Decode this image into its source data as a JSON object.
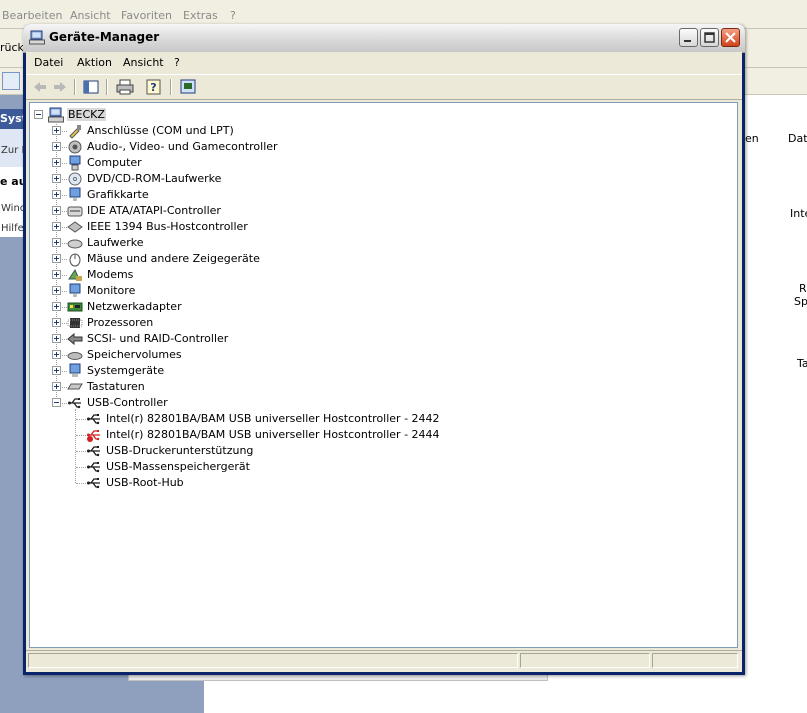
{
  "background_window": {
    "menu": [
      "Bearbeiten",
      "Ansicht",
      "Favoriten",
      "Extras",
      "?"
    ],
    "back_label": "rück",
    "left_pane": {
      "header": "Syst",
      "items": [
        "Zur K"
      ],
      "section": "e au",
      "links": [
        "Winc",
        "Hilfe"
      ]
    },
    "right_text": [
      "en",
      "Datu",
      "Inte",
      "R",
      "Sp",
      "Ta"
    ]
  },
  "device_manager": {
    "title": "Geräte-Manager",
    "menu": [
      "Datei",
      "Aktion",
      "Ansicht",
      "?"
    ],
    "tree": {
      "root": "BECKZ",
      "categories": [
        {
          "label": "Anschlüsse (COM und LPT)",
          "icon": "port-icon",
          "expanded": false
        },
        {
          "label": "Audio-, Video- und Gamecontroller",
          "icon": "speaker-icon",
          "expanded": false
        },
        {
          "label": "Computer",
          "icon": "computer-icon",
          "expanded": false
        },
        {
          "label": "DVD/CD-ROM-Laufwerke",
          "icon": "cdrom-icon",
          "expanded": false
        },
        {
          "label": "Grafikkarte",
          "icon": "monitor-icon",
          "expanded": false
        },
        {
          "label": "IDE ATA/ATAPI-Controller",
          "icon": "ide-controller-icon",
          "expanded": false
        },
        {
          "label": "IEEE 1394 Bus-Hostcontroller",
          "icon": "firewire-icon",
          "expanded": false
        },
        {
          "label": "Laufwerke",
          "icon": "disk-drive-icon",
          "expanded": false
        },
        {
          "label": "Mäuse und andere Zeigegeräte",
          "icon": "mouse-icon",
          "expanded": false
        },
        {
          "label": "Modems",
          "icon": "modem-icon",
          "expanded": false
        },
        {
          "label": "Monitore",
          "icon": "monitor-icon",
          "expanded": false
        },
        {
          "label": "Netzwerkadapter",
          "icon": "network-card-icon",
          "expanded": false
        },
        {
          "label": "Prozessoren",
          "icon": "processor-icon",
          "expanded": false
        },
        {
          "label": "SCSI- und RAID-Controller",
          "icon": "scsi-icon",
          "expanded": false
        },
        {
          "label": "Speichervolumes",
          "icon": "volume-icon",
          "expanded": false
        },
        {
          "label": "Systemgeräte",
          "icon": "system-device-icon",
          "expanded": false
        },
        {
          "label": "Tastaturen",
          "icon": "keyboard-icon",
          "expanded": false
        },
        {
          "label": "USB-Controller",
          "icon": "usb-icon",
          "expanded": true
        }
      ],
      "usb_children": [
        {
          "label": "Intel(r) 82801BA/BAM USB universeller Hostcontroller - 2442",
          "status": "ok"
        },
        {
          "label": "Intel(r) 82801BA/BAM USB universeller Hostcontroller - 2444",
          "status": "error"
        },
        {
          "label": "USB-Druckerunterstützung",
          "status": "ok"
        },
        {
          "label": "USB-Massenspeichergerät",
          "status": "ok"
        },
        {
          "label": "USB-Root-Hub",
          "status": "ok"
        }
      ]
    },
    "colors": {
      "usb_ok": "#1a1a1a",
      "usb_error": "#d02020",
      "selection": "#d9d9d9"
    }
  }
}
